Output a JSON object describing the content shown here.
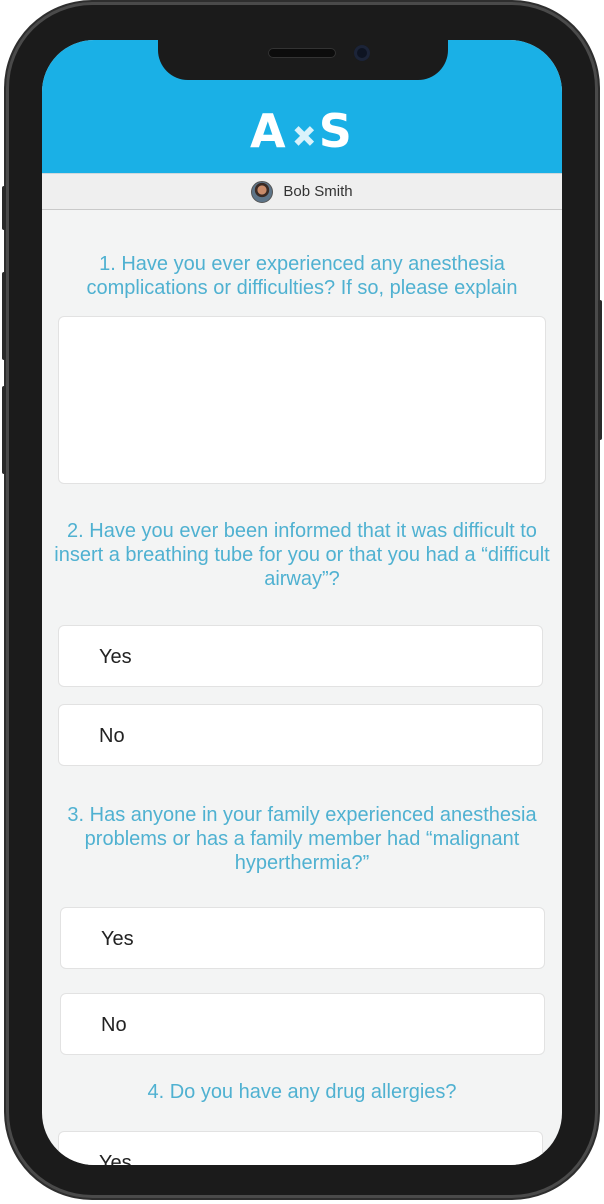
{
  "header": {
    "logo_left": "A",
    "logo_mark": "✚",
    "logo_right": "S"
  },
  "user": {
    "name": "Bob Smith"
  },
  "questions": [
    {
      "text": "1. Have you ever experienced any anesthesia complications or difficulties?  If so, please explain",
      "input_value": ""
    },
    {
      "text": "2. Have you ever been informed that it was difficult to insert a breathing tube for you or that you had a “difficult airway”?",
      "options": [
        "Yes",
        "No"
      ]
    },
    {
      "text": "3. Has anyone in your family experienced anesthesia problems or has a family member had “malignant hyperthermia?”",
      "options": [
        "Yes",
        "No"
      ]
    },
    {
      "text": "4. Do you have any drug allergies?",
      "options": [
        "Yes"
      ]
    }
  ]
}
